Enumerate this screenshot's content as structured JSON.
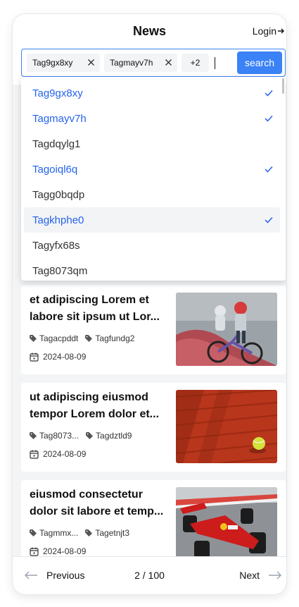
{
  "header": {
    "title": "News",
    "login_label": "Login"
  },
  "search": {
    "chips": [
      "Tag9gx8xy",
      "Tagmayv7h"
    ],
    "more_count": "+2",
    "button_label": "search"
  },
  "dropdown": {
    "options": [
      {
        "label": "Tag9gx8xy",
        "selected": true
      },
      {
        "label": "Tagmayv7h",
        "selected": true
      },
      {
        "label": "Tagdqylg1",
        "selected": false
      },
      {
        "label": "Tagoiql6q",
        "selected": true
      },
      {
        "label": "Tagg0bqdp",
        "selected": false
      },
      {
        "label": "Tagkhphe0",
        "selected": true,
        "highlighted": true
      },
      {
        "label": "Tagyfx68s",
        "selected": false
      },
      {
        "label": "Tag8073qm",
        "selected": false
      }
    ]
  },
  "articles": [
    {
      "title": "et adipiscing Lorem et labore sit ipsum ut Lor...",
      "tags": [
        "Tagacpddt",
        "Tagfundg2"
      ],
      "date": "2024-08-09",
      "image": "bmx-kids"
    },
    {
      "title": "ut adipiscing eiusmod tempor Lorem dolor et...",
      "tags": [
        "Tag8073...",
        "Tagdztld9"
      ],
      "date": "2024-08-09",
      "image": "tennis-ball-clay"
    },
    {
      "title": "eiusmod consectetur dolor sit labore et temp...",
      "tags": [
        "Tagmmx...",
        "Tagetnjt3"
      ],
      "date": "2024-08-09",
      "image": "formula-one-car"
    }
  ],
  "pagination": {
    "prev_label": "Previous",
    "page_label": "2 / 100",
    "next_label": "Next"
  },
  "colors": {
    "accent": "#3b82f6",
    "selected_text": "#2563eb",
    "background": "#f3f4f6"
  }
}
